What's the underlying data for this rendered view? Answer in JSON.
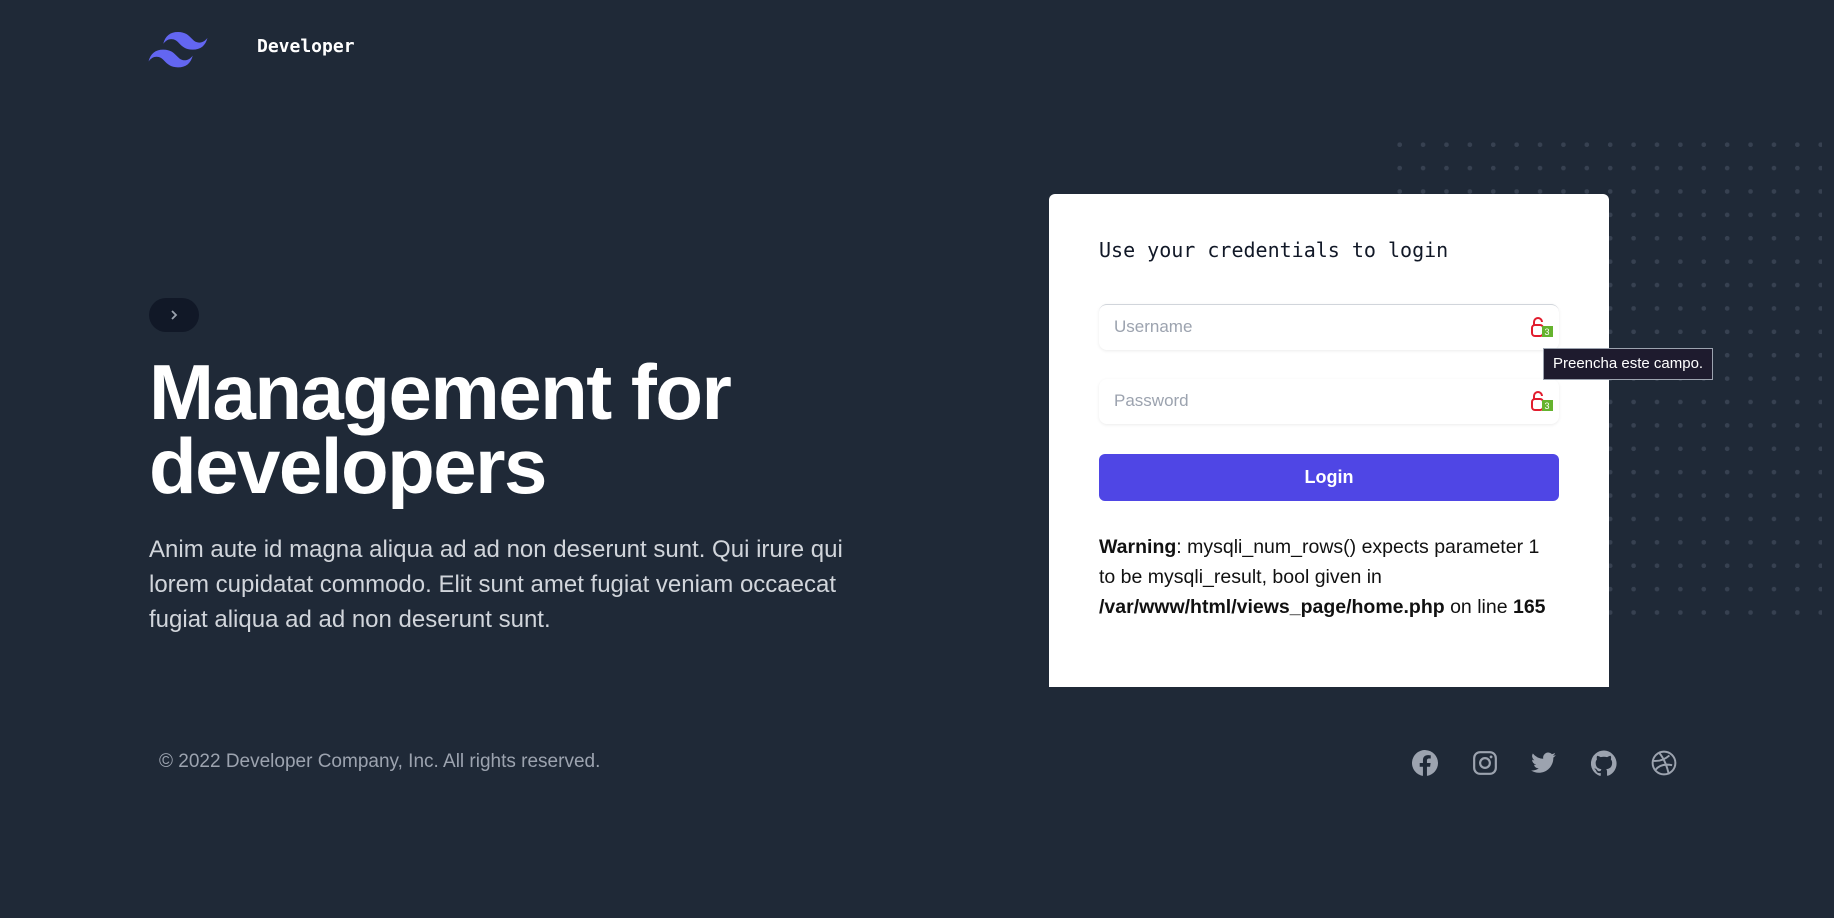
{
  "header": {
    "brand": "Developer",
    "logo_icon": "tailwind-wave-logo",
    "logo_color": "#6366f1"
  },
  "hero": {
    "pill_icon": "chevron-right-icon",
    "title": "Management for developers",
    "description": "Anim aute id magna aliqua ad ad non deserunt sunt. Qui irure qui lorem cupidatat commodo. Elit sunt amet fugiat veniam occaecat fugiat aliqua ad ad non deserunt sunt."
  },
  "login": {
    "title": "Use your credentials to login",
    "username_placeholder": "Username",
    "password_placeholder": "Password",
    "field_badge": "3",
    "button": "Login",
    "accent": "#4f46e5",
    "warning": {
      "label": "Warning",
      "message": ": mysqli_num_rows() expects parameter 1 to be mysqli_result, bool given in ",
      "file": "/var/www/html/views_page/home.php",
      "on_line": " on line ",
      "line": "165"
    },
    "tooltip": "Preencha este campo."
  },
  "footer": {
    "copyright": "© 2022 Developer Company, Inc. All rights reserved.",
    "social": [
      "facebook",
      "instagram",
      "twitter",
      "github",
      "dribbble"
    ]
  }
}
